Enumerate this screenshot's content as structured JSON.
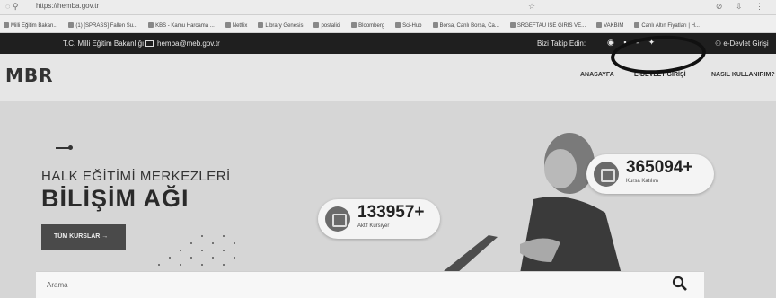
{
  "browser": {
    "url": "https://hemba.gov.tr",
    "bookmarks": [
      "Milli Eğitim Bakan...",
      "(1) [SPRASS] Fallen Su...",
      "KBS - Kamu Harcama ...",
      "Netflix",
      "Library Genesis",
      "postalici",
      "Bloomberg",
      "Sci-Hub",
      "Borsa, Canlı Borsa, Ca...",
      "SRGEFTAU ISE GIRIS VE...",
      "VAKBIM",
      "Canlı Altın Fiyatları | H..."
    ]
  },
  "topbar": {
    "ministry": "T.C. Milli Eğitim Bakanlığı",
    "email": "hemba@meb.gov.tr",
    "follow": "Bizi Takip Edin:",
    "edevlet": "e-Devlet Girişi"
  },
  "header": {
    "logo": "MBR",
    "nav": {
      "home": "ANASAYFA",
      "edevlet": "E-DEVLET GİRİŞİ",
      "how": "NASIL KULLANIRIM?"
    }
  },
  "hero": {
    "subtitle": "HALK EĞİTİMİ MERKEZLERİ",
    "title": "BİLİŞİM AĞI",
    "cta": "TÜM KURSLAR →",
    "stats": [
      {
        "value": "133957+",
        "label": "Aktif Kursiyer"
      },
      {
        "value": "365094+",
        "label": "Kursa Katılım"
      }
    ],
    "search_placeholder": "Arama"
  },
  "colors": {
    "topbar": "#1f1f1f",
    "cta": "#4a4a4a",
    "hero_bg": "#d6d6d6"
  }
}
